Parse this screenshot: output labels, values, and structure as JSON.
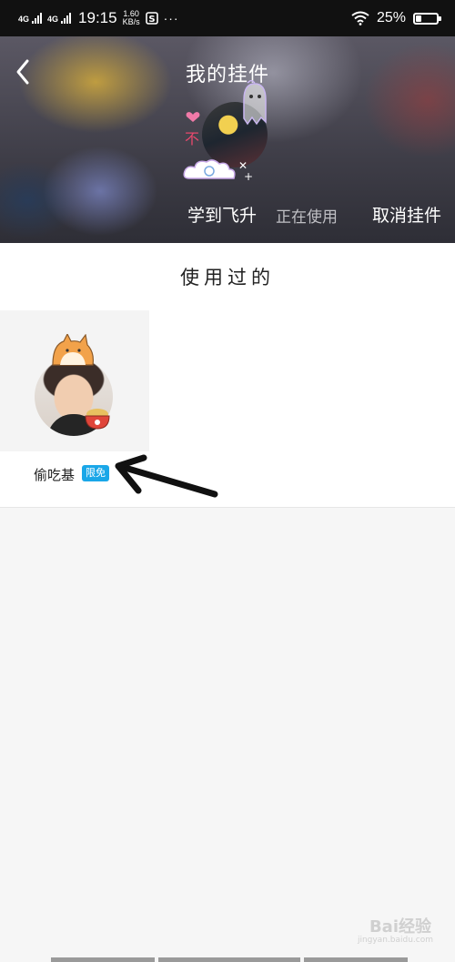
{
  "status_bar": {
    "network1": "4G",
    "network2": "4G",
    "time": "19:15",
    "speed_value": "1.60",
    "speed_unit": "KB/s",
    "more": "···",
    "battery_text": "25%",
    "battery_level": 0.25
  },
  "header": {
    "title": "我的挂件",
    "current_pendant_name": "学到飞升",
    "current_status": "正在使用",
    "cancel_label": "取消挂件"
  },
  "used_section": {
    "title": "使用过的",
    "items": [
      {
        "name": "偷吃基",
        "badge": "限免"
      }
    ]
  },
  "watermark": {
    "text": "Bai经验",
    "sub": "jingyan.baidu.com"
  },
  "colors": {
    "badge": "#1aa7e8",
    "status_bar": "#111111"
  }
}
